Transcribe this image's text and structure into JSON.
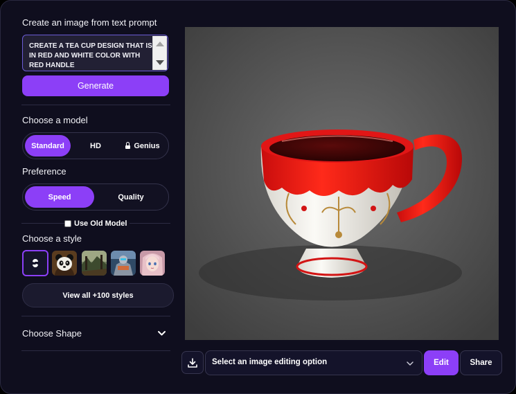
{
  "prompt_section": {
    "title": "Create an image from text prompt",
    "prompt_text": "CREATE A TEA CUP DESIGN THAT IS IN RED AND WHITE COLOR WITH RED HANDLE"
  },
  "generate_button": {
    "label": "Generate"
  },
  "model_section": {
    "title": "Choose a model",
    "options": [
      {
        "label": "Standard",
        "active": true
      },
      {
        "label": "HD",
        "active": false
      },
      {
        "label": "Genius",
        "active": false,
        "icon": "lock-icon"
      }
    ]
  },
  "preference_section": {
    "title": "Preference",
    "options": [
      {
        "label": "Speed",
        "active": true
      },
      {
        "label": "Quality",
        "active": false
      }
    ]
  },
  "old_model": {
    "label": "Use Old Model",
    "checked": false
  },
  "style_section": {
    "title": "Choose a style",
    "styles": [
      {
        "icon": "no-style-icon",
        "selected": true
      },
      {
        "icon": "panda-thumbnail"
      },
      {
        "icon": "landscape-thumbnail"
      },
      {
        "icon": "robot-thumbnail"
      },
      {
        "icon": "anime-girl-thumbnail"
      }
    ],
    "view_all_label": "View all +100 styles"
  },
  "shape_section": {
    "title": "Choose Shape"
  },
  "image": {
    "subject": "red-and-white-tea-cup-illustration"
  },
  "bottom_bar": {
    "download_icon": "download-icon",
    "edit_select_label": "Select an image editing option",
    "edit_button": "Edit",
    "share_button": "Share"
  },
  "colors": {
    "accent": "#8C3FF7",
    "background": "#0F0E1E",
    "panel_border": "#34334C"
  }
}
